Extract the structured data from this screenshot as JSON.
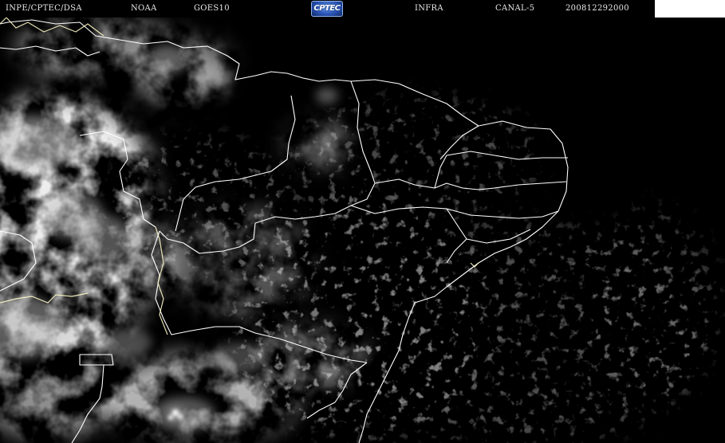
{
  "header": {
    "source": "INPE/CPTEC/DSA",
    "agency": "NOAA",
    "satellite": "GOES10",
    "logo_text": "CPTEC",
    "product": "INFRA",
    "channel": "CANAL-5",
    "timestamp": "200812292000"
  },
  "colors": {
    "background": "#000000",
    "borders": "#ffffff",
    "coastline": "#fff8c8",
    "header_text": "#e8e8e8",
    "clouds": "#c8c8c8"
  },
  "map": {
    "type": "infrared satellite image",
    "region": "Northeast Brazil"
  }
}
